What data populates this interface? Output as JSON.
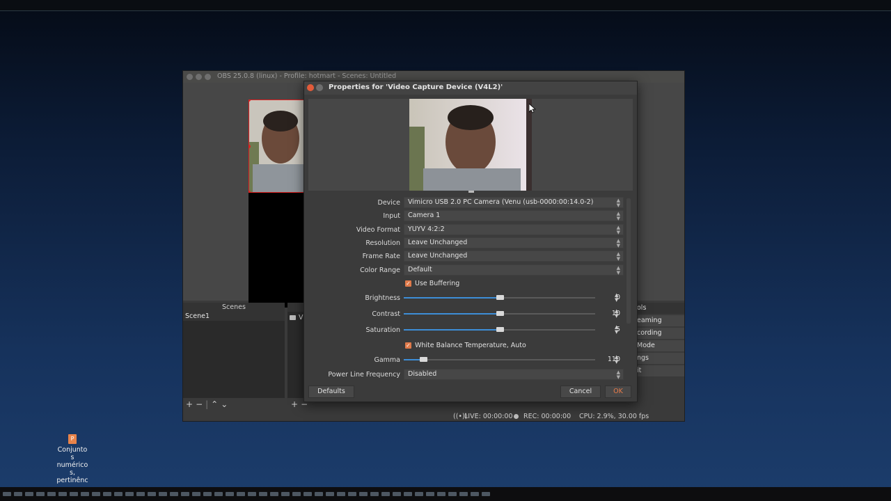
{
  "obs_window": {
    "title": "OBS 25.0.8 (linux) - Profile: hotmart - Scenes: Untitled",
    "scenes_header": "Scenes",
    "scenes": [
      "Scene1"
    ],
    "sources_stub": "V",
    "controls_header": "ols",
    "controls": [
      "eaming",
      "cording",
      "Mode",
      "ngs",
      "it"
    ],
    "status": {
      "live": "LIVE: 00:00:00",
      "rec": "REC: 00:00:00",
      "cpu": "CPU: 2.9%, 30.00 fps"
    }
  },
  "dialog": {
    "title": "Properties for 'Video Capture Device (V4L2)'",
    "device": {
      "label": "Device",
      "value": "Vimicro USB 2.0 PC Camera (Venu (usb-0000:00:14.0-2)"
    },
    "input": {
      "label": "Input",
      "value": "Camera 1"
    },
    "video_format": {
      "label": "Video Format",
      "value": "YUYV 4:2:2"
    },
    "resolution": {
      "label": "Resolution",
      "value": "Leave Unchanged"
    },
    "frame_rate": {
      "label": "Frame Rate",
      "value": "Leave Unchanged"
    },
    "color_range": {
      "label": "Color Range",
      "value": "Default"
    },
    "use_buffering": {
      "label": "Use Buffering",
      "checked": true
    },
    "brightness": {
      "label": "Brightness",
      "value": "0",
      "level": 0.5
    },
    "contrast": {
      "label": "Contrast",
      "value": "10",
      "level": 0.5
    },
    "saturation": {
      "label": "Saturation",
      "value": "5",
      "level": 0.5
    },
    "white_balance": {
      "label": "White Balance Temperature, Auto",
      "checked": true
    },
    "gamma": {
      "label": "Gamma",
      "value": "110",
      "level": 0.1
    },
    "power_line": {
      "label": "Power Line Frequency",
      "value": "Disabled"
    },
    "buttons": {
      "defaults": "Defaults",
      "cancel": "Cancel",
      "ok": "OK"
    }
  },
  "desktop_icon": {
    "label_lines": [
      "Conjunto",
      "s",
      "numérico",
      "s,",
      "pertinênc"
    ],
    "glyph": "P"
  },
  "colors": {
    "accent_blue": "#3d8ed8",
    "checkbox_orange": "#e07a4a",
    "selection_red": "#e02020",
    "ok_text": "#e97c4a"
  }
}
